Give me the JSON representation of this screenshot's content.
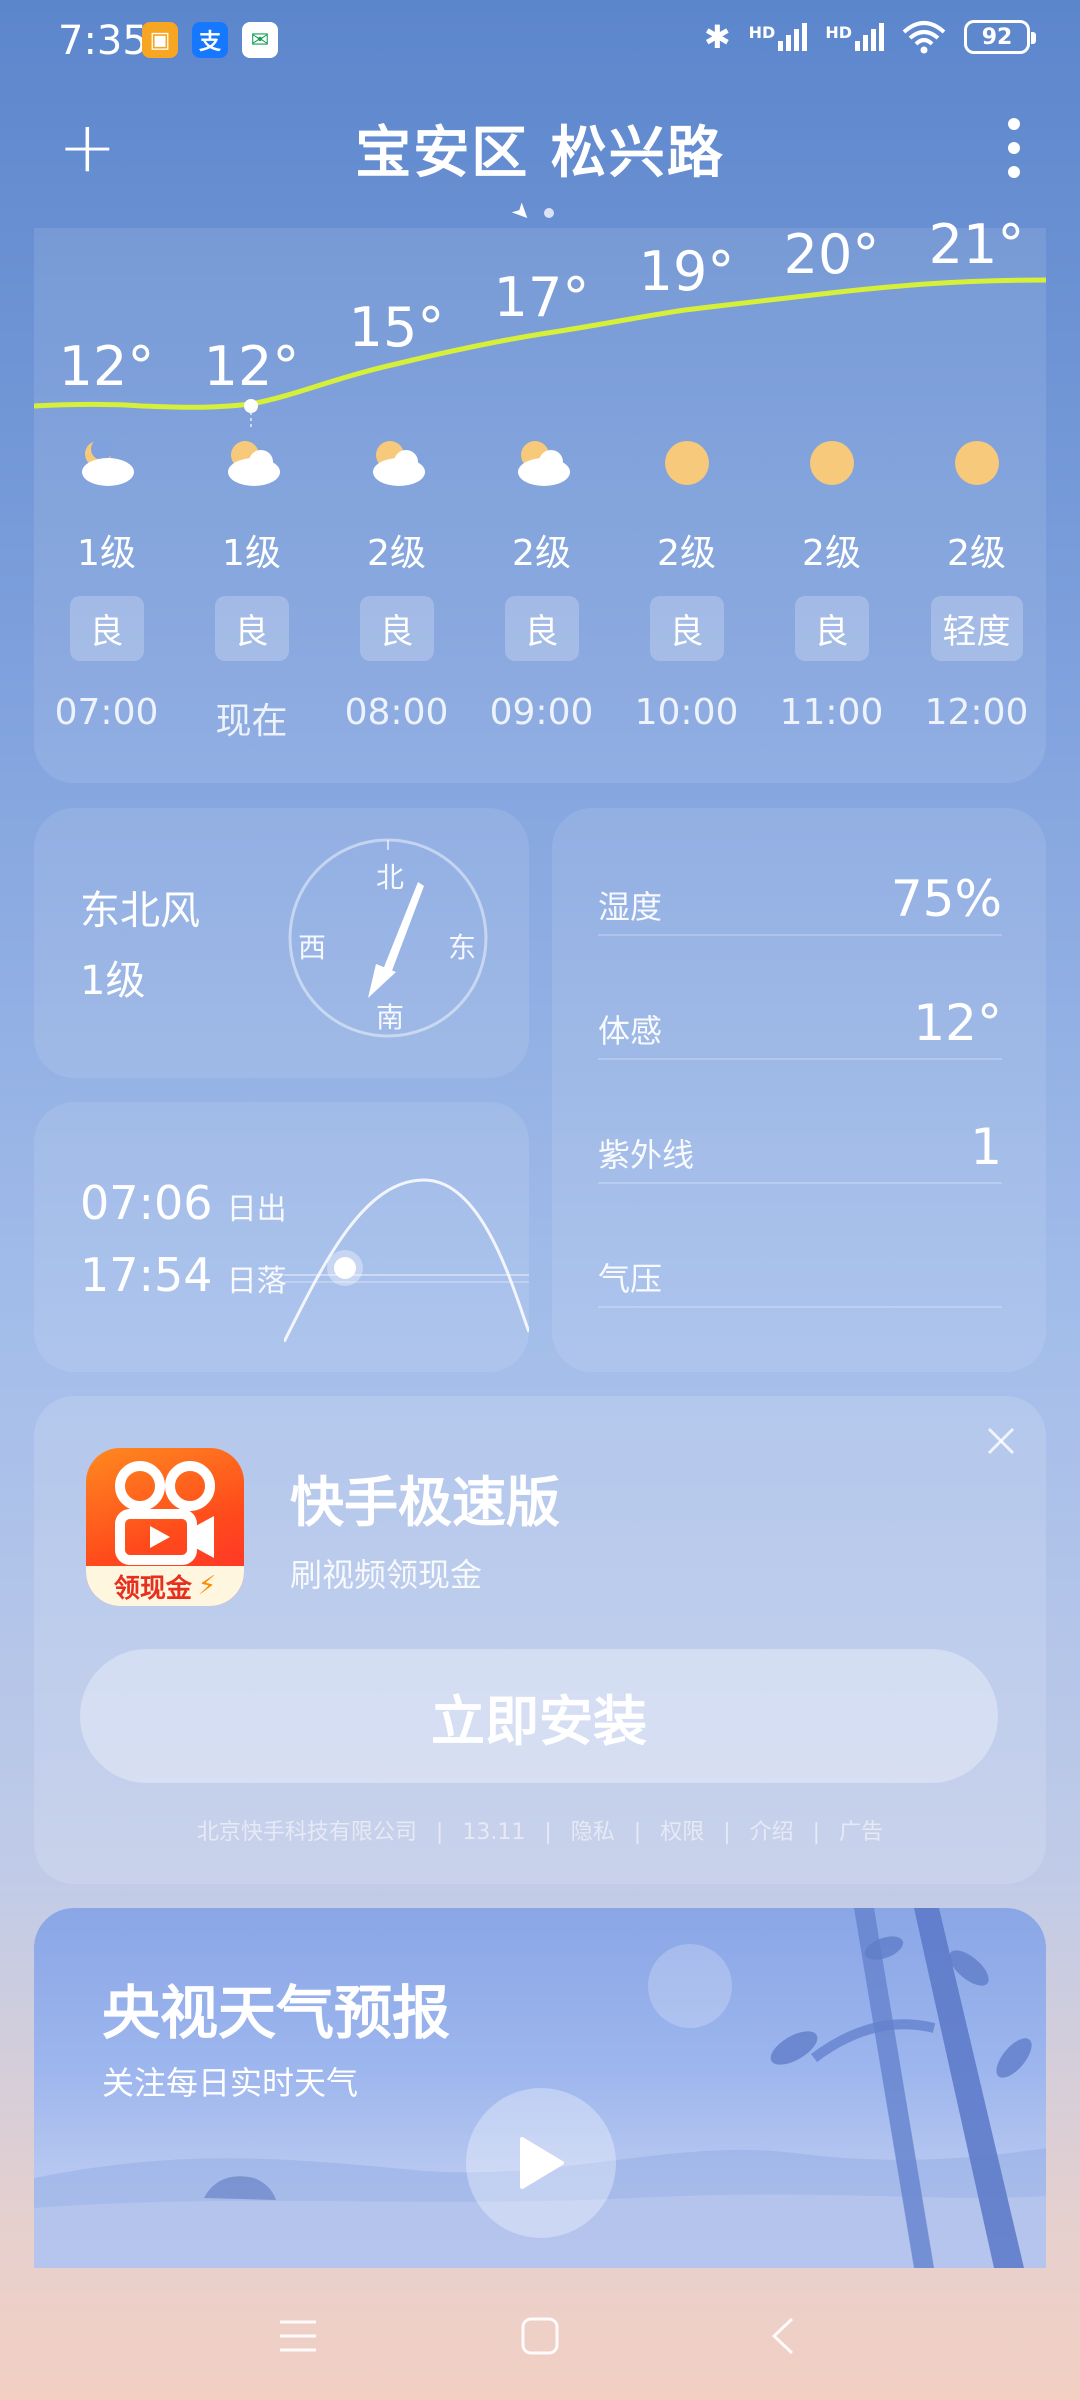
{
  "status_bar": {
    "time": "7:35",
    "notifications": [
      {
        "icon": "chat-notification-icon",
        "glyph": "▣",
        "color": "#f6a623"
      },
      {
        "icon": "alipay-icon",
        "glyph": "支",
        "color": "#1677ff"
      },
      {
        "icon": "postal-icon",
        "glyph": "✉",
        "color": "#18a058"
      }
    ],
    "signal1": "HD",
    "signal2": "HD",
    "battery": "92"
  },
  "header": {
    "location": "宝安区 松兴路"
  },
  "hourly": [
    {
      "temp": "12°",
      "weather": "partly-cloudy-night",
      "wind": "1级",
      "aqi": "良",
      "time": "07:00"
    },
    {
      "temp": "12°",
      "weather": "cloudy",
      "wind": "1级",
      "aqi": "良",
      "time": "现在"
    },
    {
      "temp": "15°",
      "weather": "cloudy",
      "wind": "2级",
      "aqi": "良",
      "time": "08:00"
    },
    {
      "temp": "17°",
      "weather": "cloudy",
      "wind": "2级",
      "aqi": "良",
      "time": "09:00"
    },
    {
      "temp": "19°",
      "weather": "sunny",
      "wind": "2级",
      "aqi": "良",
      "time": "10:00"
    },
    {
      "temp": "20°",
      "weather": "sunny",
      "wind": "2级",
      "aqi": "良",
      "time": "11:00"
    },
    {
      "temp": "21°",
      "weather": "sunny",
      "wind": "2级",
      "aqi": "轻度",
      "time": "12:00"
    }
  ],
  "wind": {
    "direction": "东北风",
    "level": "1级",
    "compass": {
      "n": "北",
      "s": "南",
      "e": "东",
      "w": "西"
    }
  },
  "sun": {
    "sunrise_time": "07:06",
    "sunrise_label": "日出",
    "sunset_time": "17:54",
    "sunset_label": "日落"
  },
  "details": [
    {
      "label": "湿度",
      "value": "75%"
    },
    {
      "label": "体感",
      "value": "12°"
    },
    {
      "label": "紫外线",
      "value": "1"
    },
    {
      "label": "气压",
      "value": ""
    }
  ],
  "ad": {
    "app_name": "快手极速版",
    "subtitle": "刷视频领现金",
    "icon_badge": "领现金",
    "install_label": "立即安装",
    "footer": [
      "北京快手科技有限公司",
      "13.11",
      "隐私",
      "权限",
      "介绍",
      "广告"
    ]
  },
  "video": {
    "title": "央视天气预报",
    "subtitle": "关注每日实时天气"
  },
  "colors": {
    "temp_line": "#d6f03a",
    "sun": "#f7c97a"
  }
}
